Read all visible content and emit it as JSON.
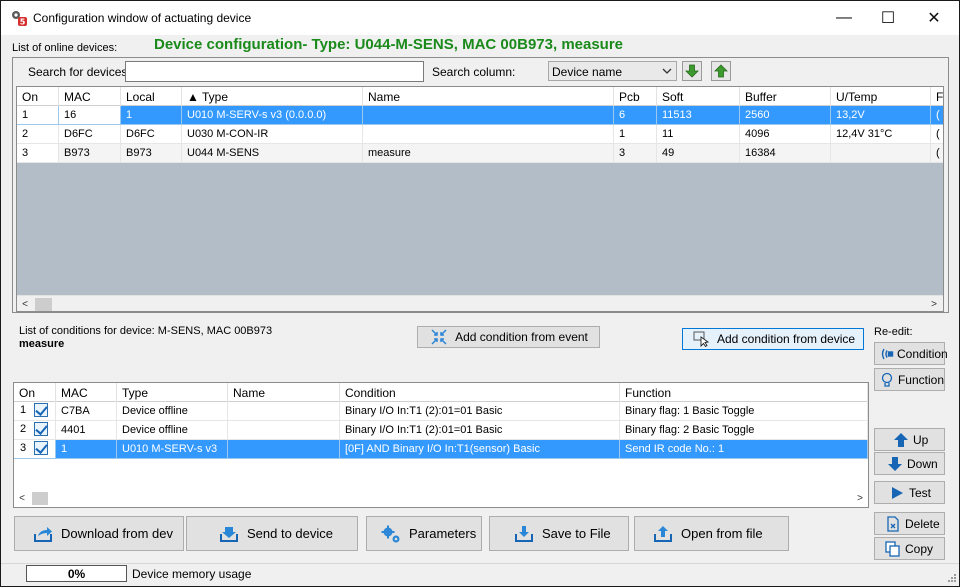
{
  "window": {
    "title": "Configuration window of actuating device",
    "minimize": "—",
    "maximize": "☐",
    "close": "✕"
  },
  "online": {
    "label": "List of online devices:",
    "heading": "Device configuration- Type: U044-M-SENS, MAC 00B973, measure",
    "search_label": "Search for devices:",
    "search_value": "",
    "search_column_label": "Search column:",
    "search_column_value": "Device name",
    "columns": [
      "On",
      "MAC",
      "Local",
      "▲ Type",
      "Name",
      "Pcb",
      "Soft",
      "Buffer",
      "U/Temp",
      "F"
    ],
    "rows": [
      [
        "1",
        "16",
        "1",
        "U010 M-SERV-s v3 (0.0.0.0)",
        "",
        "6",
        "11513",
        "2560",
        "13,2V",
        "("
      ],
      [
        "2",
        "D6FC",
        "D6FC",
        "U030 M-CON-IR",
        "",
        "1",
        "11",
        "4096",
        "12,4V 31°C",
        "("
      ],
      [
        "3",
        "B973",
        "B973",
        "U044 M-SENS",
        "measure",
        "3",
        "49",
        "16384",
        "",
        "("
      ]
    ]
  },
  "conditions": {
    "label": "List of conditions for device: M-SENS, MAC 00B973",
    "device_name": "measure",
    "add_from_event": "Add condition from event",
    "add_from_device": "Add condition from device",
    "columns": [
      "On",
      "MAC",
      "Type",
      "Name",
      "Condition",
      "Function"
    ],
    "rows": [
      {
        "on": "1",
        "mac": "C7BA",
        "type": "Device offline",
        "name": "",
        "condition": "Binary I/O In:T1  (2):01=01  Basic",
        "function": "Binary flag:  1  Basic Toggle"
      },
      {
        "on": "2",
        "mac": "4401",
        "type": "Device offline",
        "name": "",
        "condition": "Binary I/O In:T1  (2):01=01  Basic",
        "function": "Binary flag:  2  Basic Toggle"
      },
      {
        "on": "3",
        "mac": "1",
        "type": "U010 M-SERV-s v3",
        "name": "",
        "condition": "[0F] AND  Binary I/O In:T1(sensor)   Basic",
        "function": "Send IR code No.: 1"
      }
    ]
  },
  "side": {
    "reedit_label": "Re-edit:",
    "condition": "Condition",
    "function": "Function",
    "up": "Up",
    "down": "Down",
    "test": "Test",
    "delete": "Delete",
    "copy": "Copy"
  },
  "bottom": {
    "download": "Download from dev",
    "send": "Send to device",
    "parameters": "Parameters",
    "save": "Save to File",
    "open": "Open from file"
  },
  "status": {
    "memory_percent": "0%",
    "memory_label": "Device memory usage"
  },
  "colors": {
    "heading": "#1a8a1a",
    "selection": "#3399ff",
    "grid_empty": "#b3bdc8",
    "icon_blue": "#1766b5",
    "arrow_green": "#3c9a2e"
  }
}
